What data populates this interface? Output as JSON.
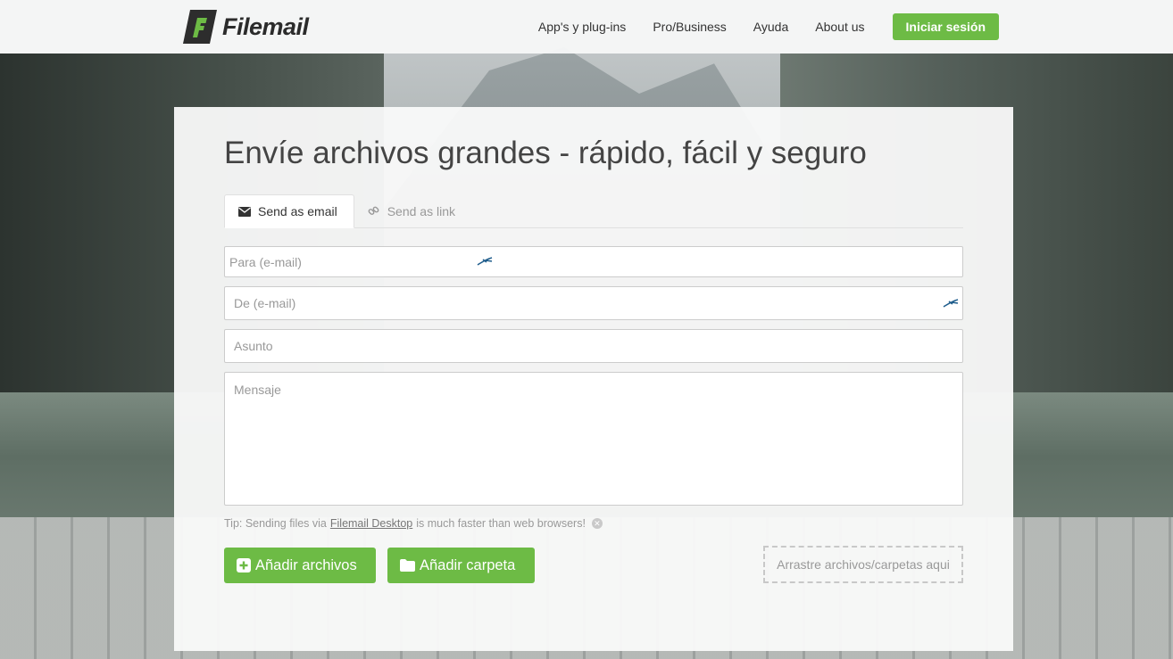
{
  "header": {
    "logo_text": "Filemail",
    "nav": [
      {
        "label": "App's y plug-ins"
      },
      {
        "label": "Pro/Business"
      },
      {
        "label": "Ayuda"
      },
      {
        "label": "About us"
      }
    ],
    "login_label": "Iniciar sesión"
  },
  "main": {
    "title": "Envíe archivos grandes - rápido, fácil y seguro",
    "tabs": [
      {
        "label": "Send as email",
        "icon": "envelope-icon",
        "active": true
      },
      {
        "label": "Send as link",
        "icon": "link-icon",
        "active": false
      }
    ],
    "form": {
      "to_placeholder": "Para (e-mail)",
      "from_placeholder": "De (e-mail)",
      "subject_placeholder": "Asunto",
      "message_placeholder": "Mensaje"
    },
    "tip": {
      "prefix": "Tip: Sending files via",
      "link": "Filemail Desktop",
      "suffix": "is much faster than web browsers!"
    },
    "buttons": {
      "add_files": "Añadir archivos",
      "add_folder": "Añadir carpeta"
    },
    "dropzone_label": "Arrastre archivos/carpetas aqui"
  },
  "colors": {
    "accent": "#6dbb45",
    "text": "#444444",
    "placeholder": "#999999"
  }
}
